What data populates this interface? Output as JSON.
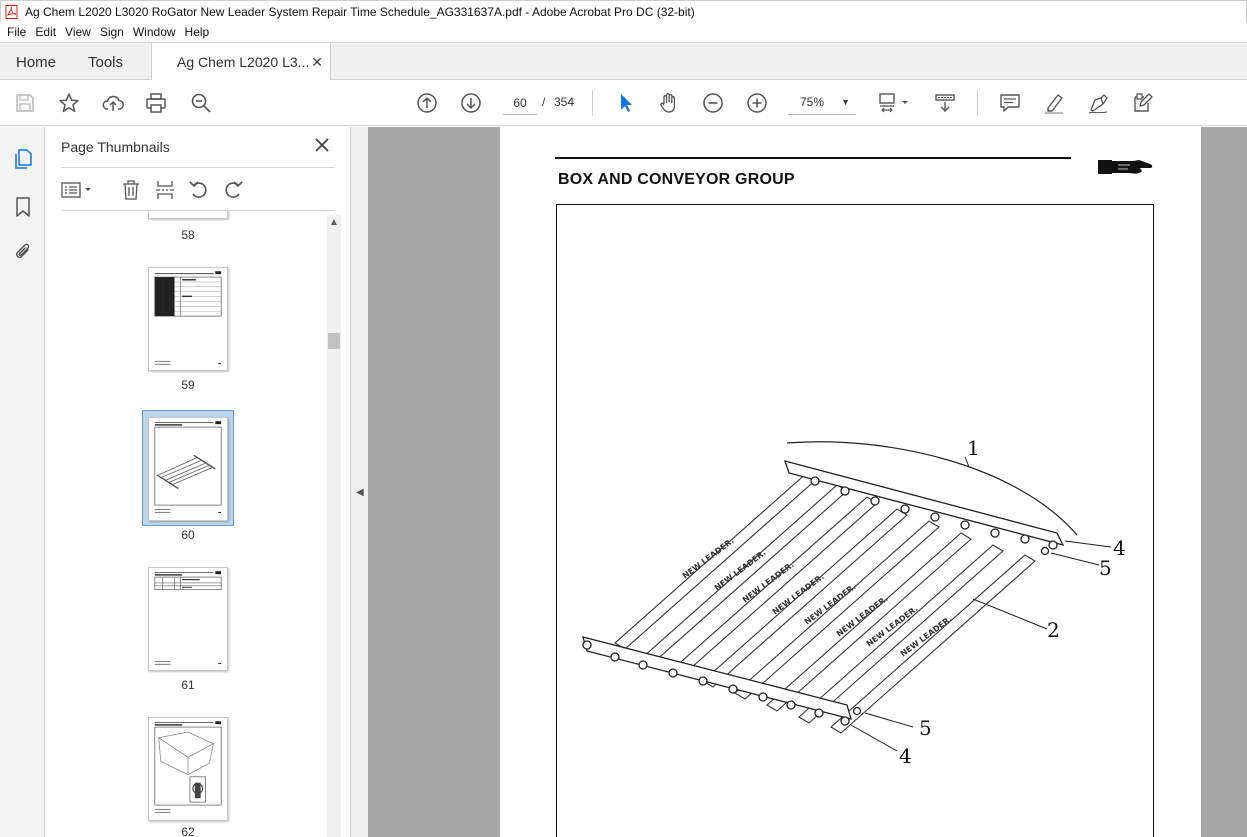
{
  "window": {
    "title": "Ag Chem L2020 L3020 RoGator New Leader System Repair Time Schedule_AG331637A.pdf - Adobe Acrobat Pro DC (32-bit)"
  },
  "menu": [
    "File",
    "Edit",
    "View",
    "Sign",
    "Window",
    "Help"
  ],
  "tabs": {
    "home": "Home",
    "tools": "Tools",
    "document": "Ag Chem L2020 L3..."
  },
  "toolbar": {
    "current_page": "60",
    "page_sep": "/",
    "total_pages": "354",
    "zoom": "75%"
  },
  "panel": {
    "title": "Page Thumbnails",
    "thumbnails": [
      {
        "page": "58"
      },
      {
        "page": "59"
      },
      {
        "page": "60",
        "selected": true
      },
      {
        "page": "61"
      },
      {
        "page": "62"
      }
    ]
  },
  "document": {
    "heading": "BOX AND CONVEYOR GROUP",
    "callouts": [
      "1",
      "4",
      "5",
      "2",
      "5",
      "4"
    ]
  },
  "colors": {
    "accent": "#1473e6",
    "selection": "#bcd6ee",
    "canvas": "#a8a8a8"
  }
}
